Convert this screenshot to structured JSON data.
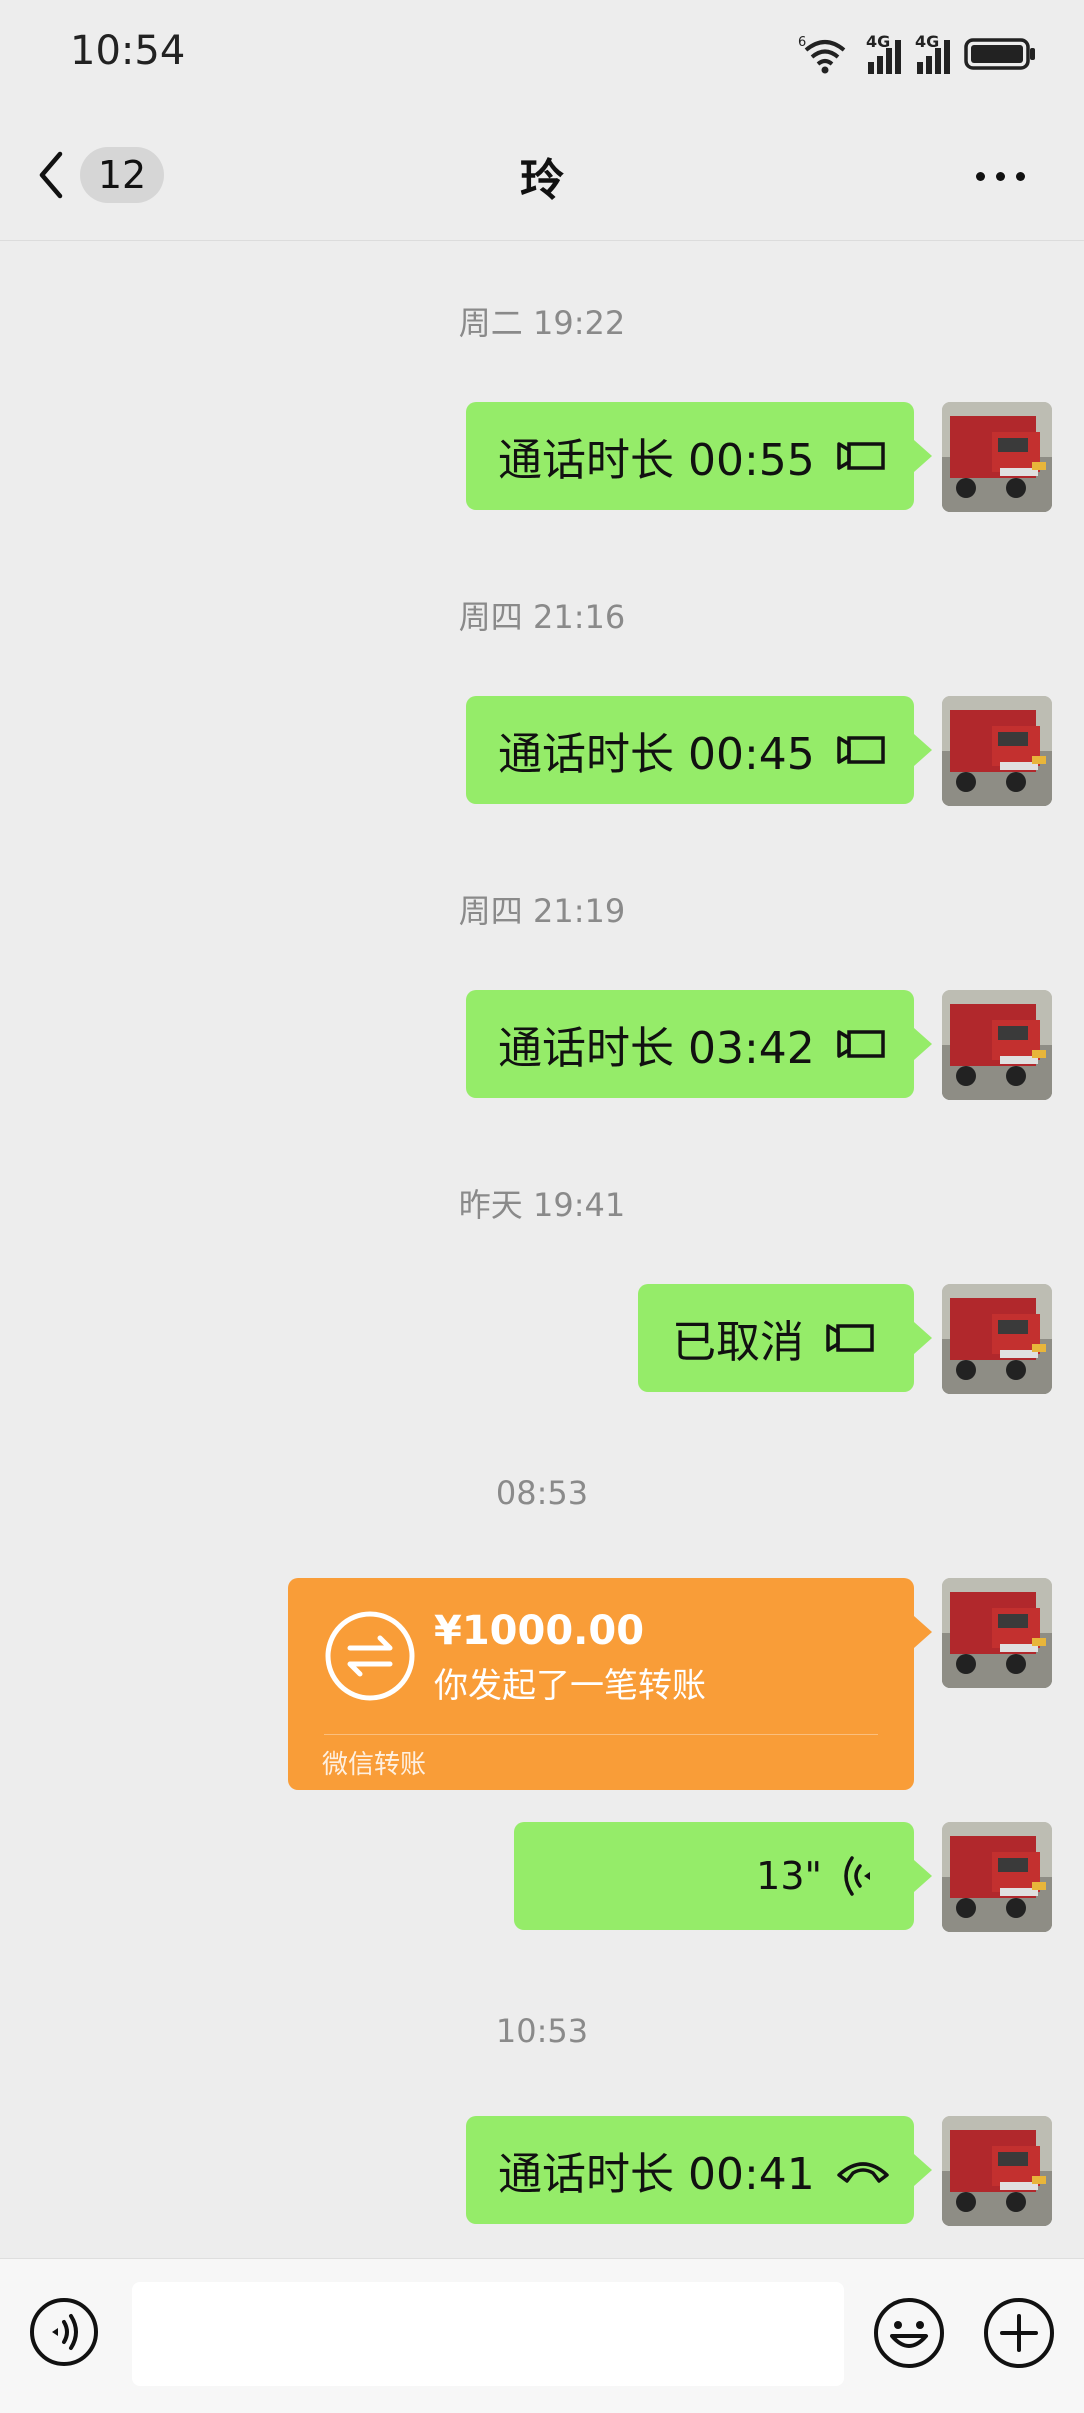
{
  "status_bar": {
    "time": "10:54",
    "network_1": "4G",
    "network_2": "4G"
  },
  "header": {
    "back_count": "12",
    "title": "玲"
  },
  "messages": [
    {
      "timestamp": "周二 19:22",
      "text": "通话时长 00:55"
    },
    {
      "timestamp": "周四 21:16",
      "text": "通话时长 00:45"
    },
    {
      "timestamp": "周四 21:19",
      "text": "通话时长 03:42"
    },
    {
      "timestamp": "昨天 19:41",
      "text": "已取消"
    }
  ],
  "transfer": {
    "timestamp": "08:53",
    "amount": "¥1000.00",
    "description": "你发起了一笔转账",
    "label": "微信转账"
  },
  "voice": {
    "duration": "13\""
  },
  "last_call": {
    "timestamp": "10:53",
    "text": "通话时长 00:41"
  },
  "input_bar": {
    "placeholder": ""
  },
  "colors": {
    "bubble_green": "#95ec69",
    "transfer_orange": "#f99d38",
    "background": "#ededed"
  }
}
